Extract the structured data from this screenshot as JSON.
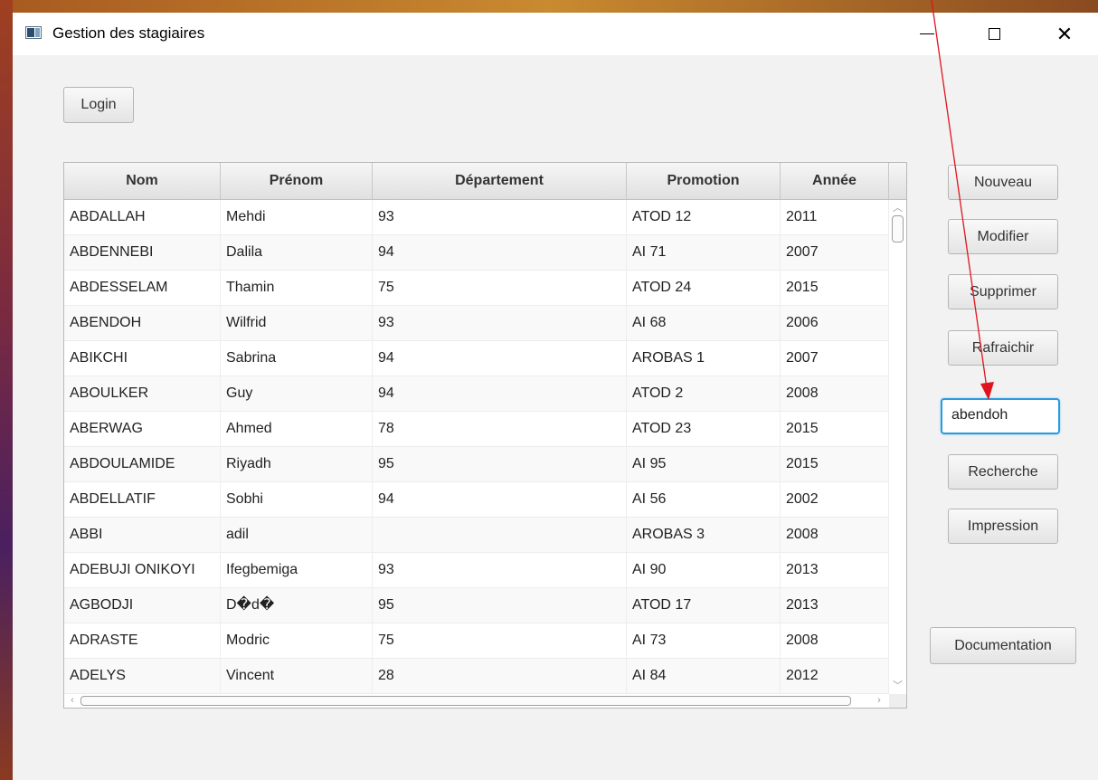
{
  "window": {
    "title": "Gestion des stagiaires",
    "controls": {
      "minimize": "minimize-icon",
      "maximize": "maximize-icon",
      "close": "✕"
    }
  },
  "toolbar": {
    "login_label": "Login"
  },
  "table": {
    "columns": [
      "Nom",
      "Prénom",
      "Département",
      "Promotion",
      "Année"
    ],
    "rows": [
      [
        "ABDALLAH",
        "Mehdi",
        "93",
        "ATOD 12",
        "2011"
      ],
      [
        "ABDENNEBI",
        "Dalila",
        "94",
        "AI 71",
        "2007"
      ],
      [
        "ABDESSELAM",
        "Thamin",
        "75",
        "ATOD 24",
        "2015"
      ],
      [
        "ABENDOH",
        "Wilfrid",
        "93",
        "AI 68",
        "2006"
      ],
      [
        "ABIKCHI",
        "Sabrina",
        "94",
        "AROBAS 1",
        "2007"
      ],
      [
        "ABOULKER",
        "Guy",
        "94",
        "ATOD 2",
        "2008"
      ],
      [
        "ABERWAG",
        "Ahmed",
        "78",
        "ATOD 23",
        "2015"
      ],
      [
        "ABDOULAMIDE",
        "Riyadh",
        "95",
        "AI 95",
        "2015"
      ],
      [
        "ABDELLATIF",
        "Sobhi",
        "94",
        "AI 56",
        "2002"
      ],
      [
        "ABBI",
        "adil",
        "",
        "AROBAS 3",
        "2008"
      ],
      [
        "ADEBUJI ONIKOYI",
        "Ifegbemiga",
        "93",
        "AI 90",
        "2013"
      ],
      [
        "AGBODJI",
        "D�d�",
        "95",
        "ATOD 17",
        "2013"
      ],
      [
        "ADRASTE",
        "Modric",
        "75",
        "AI 73",
        "2008"
      ],
      [
        "ADELYS",
        "Vincent",
        "28",
        "AI 84",
        "2012"
      ]
    ]
  },
  "actions": {
    "nouveau": "Nouveau",
    "modifier": "Modifier",
    "supprimer": "Supprimer",
    "rafraichir": "Rafraichir",
    "recherche": "Recherche",
    "impression": "Impression",
    "documentation": "Documentation"
  },
  "search": {
    "value": "abendoh"
  },
  "annotation": {
    "arrow_color": "#e0141e"
  }
}
